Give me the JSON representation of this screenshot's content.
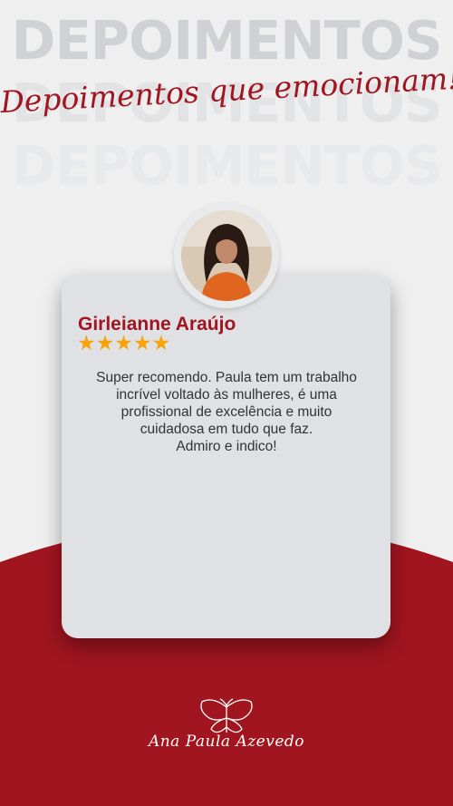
{
  "background_words": [
    "DEPOIMENTOS",
    "DEPOIMENTOS",
    "DEPOIMENTOS"
  ],
  "title": "Depoimentos que emocionam!",
  "testimonial": {
    "name": "Girleianne Araújo",
    "rating": 5,
    "stars": "★★★★★",
    "quote_lines": [
      "Super recomendo. Paula tem um trabalho",
      "incrível voltado às mulheres, é uma",
      "profissional de excelência e muito",
      "cuidadosa em tudo que faz.",
      "Admiro e indico!"
    ]
  },
  "brand": {
    "name": "Ana Paula Azevedo",
    "logo_icon": "butterfly-icon"
  },
  "colors": {
    "accent_red": "#a0151f",
    "background": "#efeff0",
    "card": "#dfe1e4",
    "star": "#f5a40b"
  }
}
